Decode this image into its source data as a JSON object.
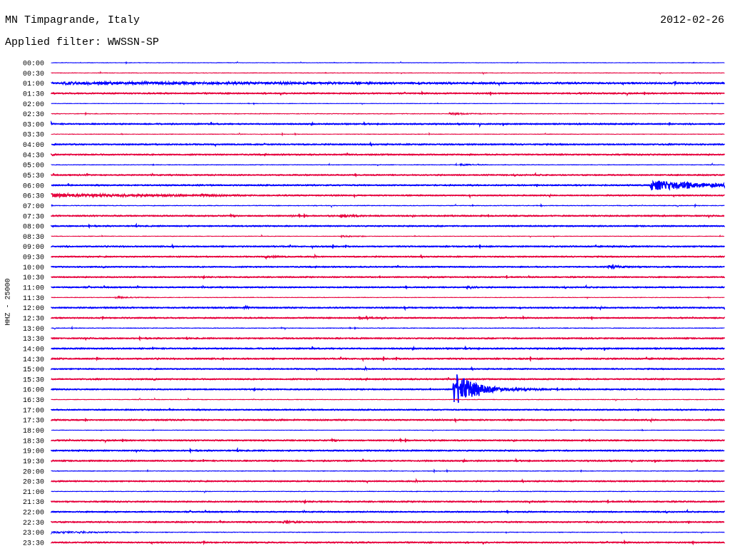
{
  "header": {
    "station": "MN Timpagrande, Italy",
    "date": "2012-02-26",
    "filter": "Applied filter: WWSSN-SP",
    "channel_label": "HHZ - 25000"
  },
  "chart_data": {
    "type": "line",
    "title": "MN Timpagrande, Italy",
    "subtitle": "Applied filter: WWSSN-SP",
    "ylabel": "HHZ - 25000",
    "row_minutes": 30,
    "colors": [
      "#0000ff",
      "#e6003c"
    ],
    "rows": [
      "00:00",
      "00:30",
      "01:00",
      "01:30",
      "02:00",
      "02:30",
      "03:00",
      "03:30",
      "04:00",
      "04:30",
      "05:00",
      "05:30",
      "06:00",
      "06:30",
      "07:00",
      "07:30",
      "08:00",
      "08:30",
      "09:00",
      "09:30",
      "10:00",
      "10:30",
      "11:00",
      "11:30",
      "12:00",
      "12:30",
      "13:00",
      "13:30",
      "14:00",
      "14:30",
      "15:00",
      "15:30",
      "16:00",
      "16:30",
      "17:00",
      "17:30",
      "18:00",
      "18:30",
      "19:00",
      "19:30",
      "20:00",
      "20:30",
      "21:00",
      "21:30",
      "22:00",
      "22:30",
      "23:00",
      "23:30"
    ],
    "noise": [
      0.4,
      0.5,
      1.0,
      0.9,
      0.4,
      0.7,
      0.9,
      0.5,
      0.9,
      0.9,
      0.6,
      0.8,
      0.9,
      0.8,
      0.7,
      0.9,
      0.8,
      0.5,
      0.9,
      0.8,
      0.8,
      0.8,
      0.8,
      0.5,
      0.9,
      0.8,
      0.7,
      0.9,
      1.0,
      1.0,
      0.8,
      0.9,
      0.8,
      0.5,
      0.8,
      0.9,
      0.4,
      0.9,
      0.9,
      0.9,
      0.6,
      0.8,
      0.6,
      0.9,
      0.8,
      0.9,
      0.6,
      0.9
    ],
    "events": [
      {
        "row": "01:00",
        "start_min": 0.5,
        "amp": 1.2,
        "decay_min": 10
      },
      {
        "row": "02:30",
        "start_min": 17.7,
        "amp": 1.5,
        "decay_min": 0.6
      },
      {
        "row": "05:00",
        "start_min": 18.2,
        "amp": 1.3,
        "decay_min": 0.5
      },
      {
        "row": "06:00",
        "start_min": 26.7,
        "amp": 7,
        "decay_min": 2.5
      },
      {
        "row": "06:30",
        "start_min": 0,
        "amp": 2.2,
        "decay_min": 3
      },
      {
        "row": "06:30",
        "start_min": 6.6,
        "amp": 1.5,
        "decay_min": 0.4
      },
      {
        "row": "07:30",
        "start_min": 12.9,
        "amp": 1.6,
        "decay_min": 0.4
      },
      {
        "row": "08:30",
        "start_min": 12.9,
        "amp": 1.6,
        "decay_min": 0.4
      },
      {
        "row": "09:30",
        "start_min": 9.5,
        "amp": 1.2,
        "decay_min": 0.4
      },
      {
        "row": "10:00",
        "start_min": 24.8,
        "amp": 1.6,
        "decay_min": 0.6
      },
      {
        "row": "11:00",
        "start_min": 18.5,
        "amp": 1.8,
        "decay_min": 0.2
      },
      {
        "row": "11:30",
        "start_min": 2.8,
        "amp": 1.8,
        "decay_min": 0.6
      },
      {
        "row": "12:00",
        "start_min": 8.6,
        "amp": 1.5,
        "decay_min": 0.2
      },
      {
        "row": "12:30",
        "start_min": 13.7,
        "amp": 1.6,
        "decay_min": 0.5
      },
      {
        "row": "16:00",
        "start_min": 17.9,
        "amp": 26,
        "decay_min": 0.9
      },
      {
        "row": "22:30",
        "start_min": 10.3,
        "amp": 1.5,
        "decay_min": 0.4
      },
      {
        "row": "23:00",
        "start_min": 0,
        "amp": 1.6,
        "decay_min": 1.8
      }
    ]
  }
}
